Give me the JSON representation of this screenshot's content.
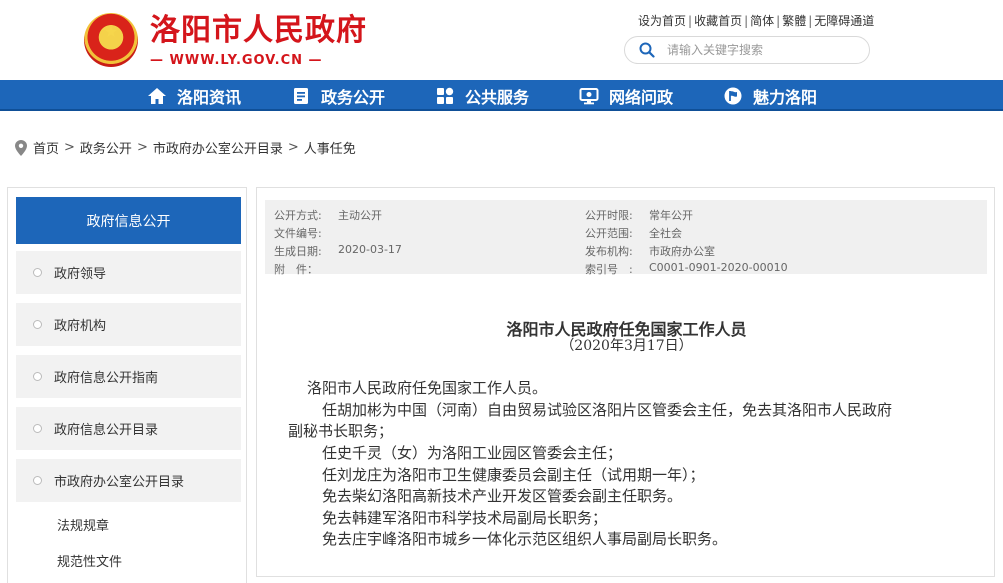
{
  "header": {
    "site_title": "洛阳市人民政府",
    "site_url": "— WWW.LY.GOV.CN —",
    "top_links": [
      "设为首页",
      "收藏首页",
      "简体",
      "繁體",
      "无障碍通道"
    ],
    "search_placeholder": "请输入关键字搜索"
  },
  "nav": {
    "items": [
      {
        "label": "洛阳资讯",
        "icon": "home-icon"
      },
      {
        "label": "政务公开",
        "icon": "document-icon"
      },
      {
        "label": "公共服务",
        "icon": "grid-icon"
      },
      {
        "label": "网络问政",
        "icon": "monitor-icon"
      },
      {
        "label": "魅力洛阳",
        "icon": "flag-icon"
      }
    ]
  },
  "breadcrumb": [
    "首页",
    "政务公开",
    "市政府办公室公开目录",
    "人事任免"
  ],
  "sidebar": {
    "title": "政府信息公开",
    "items": [
      "政府领导",
      "政府机构",
      "政府信息公开指南",
      "政府信息公开目录",
      "市政府办公室公开目录"
    ],
    "subitems": [
      "法规规章",
      "规范性文件"
    ]
  },
  "meta": {
    "left": [
      {
        "key": "公开方式:",
        "value": "主动公开"
      },
      {
        "key": "文件编号:",
        "value": ""
      },
      {
        "key": "生成日期:",
        "value": "2020-03-17"
      },
      {
        "key": "附　件：",
        "value": ""
      }
    ],
    "right": [
      {
        "key": "公开时限:",
        "value": "常年公开"
      },
      {
        "key": "公开范围:",
        "value": "全社会"
      },
      {
        "key": "发布机构:",
        "value": "市政府办公室"
      },
      {
        "key": "索引号　:",
        "value": "C0001-0901-2020-00010"
      }
    ]
  },
  "article": {
    "title": "洛阳市人民政府任免国家工作人员",
    "date": "（2020年3月17日）",
    "lines": [
      "洛阳市人民政府任免国家工作人员。",
      "任胡加彬为中国（河南）自由贸易试验区洛阳片区管委会主任，免去其洛阳市人民政府",
      "副秘书长职务；",
      "任史千灵（女）为洛阳工业园区管委会主任；",
      "任刘龙庄为洛阳市卫生健康委员会副主任（试用期一年）；",
      "免去柴幻洛阳高新技术产业开发区管委会副主任职务。",
      "免去韩建军洛阳市科学技术局副局长职务；",
      "免去庄宇峰洛阳市城乡一体化示范区组织人事局副局长职务。"
    ]
  },
  "colors": {
    "brand_red": "#d4151b",
    "nav_blue": "#1d66b9"
  }
}
